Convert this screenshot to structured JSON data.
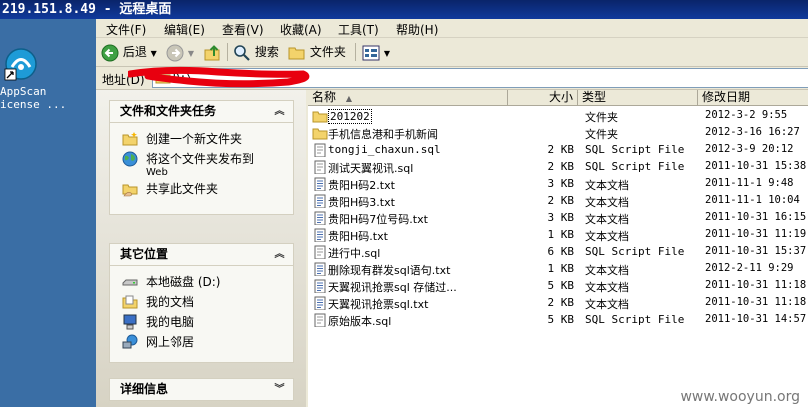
{
  "remote_title": {
    "ip": "219.151.8.49",
    "sep": " - ",
    "label": "远程桌面"
  },
  "desktop_icon": {
    "label_line1": "AppScan",
    "label_line2": "icense ..."
  },
  "menu": [
    "文件(F)",
    "编辑(E)",
    "查看(V)",
    "收藏(A)",
    "工具(T)",
    "帮助(H)"
  ],
  "toolbar": {
    "back": "后退",
    "search": "搜索",
    "folders": "文件夹"
  },
  "address": {
    "label": "地址(D)",
    "value": "D:\\"
  },
  "tasks_panel": {
    "title": "文件和文件夹任务",
    "items": [
      "创建一个新文件夹",
      "将这个文件夹发布到",
      "Web",
      "共享此文件夹"
    ]
  },
  "places_panel": {
    "title": "其它位置",
    "items": [
      "本地磁盘 (D:)",
      "我的文档",
      "我的电脑",
      "网上邻居"
    ]
  },
  "details_panel": {
    "title": "详细信息"
  },
  "columns": {
    "name": "名称",
    "size": "大小",
    "type": "类型",
    "date": "修改日期"
  },
  "files": [
    {
      "name": "201202",
      "size": "",
      "type": "文件夹",
      "date": "2012-3-2 9:55",
      "kind": "folder"
    },
    {
      "name": "手机信息港和手机新闻",
      "size": "",
      "type": "文件夹",
      "date": "2012-3-16 16:27",
      "kind": "folder"
    },
    {
      "name": "tongji_chaxun.sql",
      "size": "2 KB",
      "type": "SQL Script File",
      "date": "2012-3-9 20:12",
      "kind": "sql"
    },
    {
      "name": "测试天翼视讯.sql",
      "size": "2 KB",
      "type": "SQL Script File",
      "date": "2011-10-31 15:38",
      "kind": "sql"
    },
    {
      "name": "贵阳H码2.txt",
      "size": "3 KB",
      "type": "文本文档",
      "date": "2011-11-1 9:48",
      "kind": "txt"
    },
    {
      "name": "贵阳H码3.txt",
      "size": "2 KB",
      "type": "文本文档",
      "date": "2011-11-1 10:04",
      "kind": "txt"
    },
    {
      "name": "贵阳H码7位号码.txt",
      "size": "3 KB",
      "type": "文本文档",
      "date": "2011-10-31 16:15",
      "kind": "txt"
    },
    {
      "name": "贵阳H码.txt",
      "size": "1 KB",
      "type": "文本文档",
      "date": "2011-10-31 11:19",
      "kind": "txt"
    },
    {
      "name": "进行中.sql",
      "size": "6 KB",
      "type": "SQL Script File",
      "date": "2011-10-31 15:37",
      "kind": "sql"
    },
    {
      "name": "删除现有群发sql语句.txt",
      "size": "1 KB",
      "type": "文本文档",
      "date": "2012-2-11 9:29",
      "kind": "txt"
    },
    {
      "name": "天翼视讯抢票sql 存储过...",
      "size": "5 KB",
      "type": "文本文档",
      "date": "2011-10-31 11:18",
      "kind": "txt"
    },
    {
      "name": "天翼视讯抢票sql.txt",
      "size": "2 KB",
      "type": "文本文档",
      "date": "2011-10-31 11:18",
      "kind": "txt"
    },
    {
      "name": "原始版本.sql",
      "size": "5 KB",
      "type": "SQL Script File",
      "date": "2011-10-31 14:57",
      "kind": "sql"
    }
  ],
  "watermark": "www.wooyun.org",
  "colors": {
    "title_bar": "#0a246a",
    "desktop": "#3a6ea5",
    "redaction": "#e8000f",
    "chrome": "#ece9d8"
  }
}
